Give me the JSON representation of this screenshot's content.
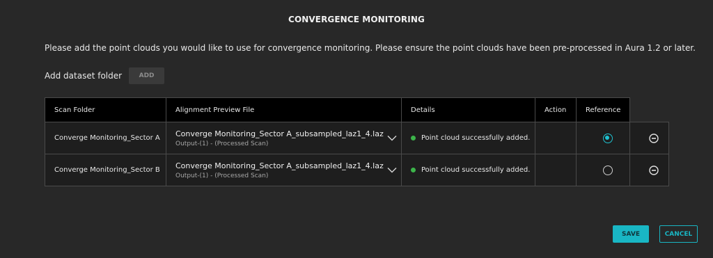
{
  "dialog": {
    "title": "CONVERGENCE MONITORING",
    "intro": "Please add the point clouds you would like to use for convergence monitoring. Please ensure the point clouds have been pre-processed in Aura 1.2 or later.",
    "add_dataset_label": "Add dataset folder",
    "add_button": "ADD"
  },
  "table": {
    "headers": {
      "scan_folder": "Scan Folder",
      "alignment_preview": "Alignment Preview File",
      "details": "Details",
      "action": "Action",
      "reference": "Reference"
    },
    "rows": [
      {
        "scan_folder": "Converge Monitoring_Sector A",
        "file_name": "Converge Monitoring_Sector A_subsampled_laz1_4.laz",
        "file_sub": "Output-(1) - (Processed Scan)",
        "detail": "Point cloud successfully added.",
        "reference_selected": true
      },
      {
        "scan_folder": "Converge Monitoring_Sector B",
        "file_name": "Converge Monitoring_Sector A_subsampled_laz1_4.laz",
        "file_sub": "Output-(1) - (Processed Scan)",
        "detail": "Point cloud successfully added.",
        "reference_selected": false
      }
    ]
  },
  "footer": {
    "save_label": "SAVE",
    "cancel_label": "CANCEL"
  },
  "colors": {
    "accent": "#19b6c4",
    "success": "#3cb44a",
    "background": "#282828",
    "header": "#000000"
  },
  "icons": {
    "dropdown": "chevron-down-icon",
    "remove": "minus-circle-icon",
    "status": "status-dot-icon"
  }
}
